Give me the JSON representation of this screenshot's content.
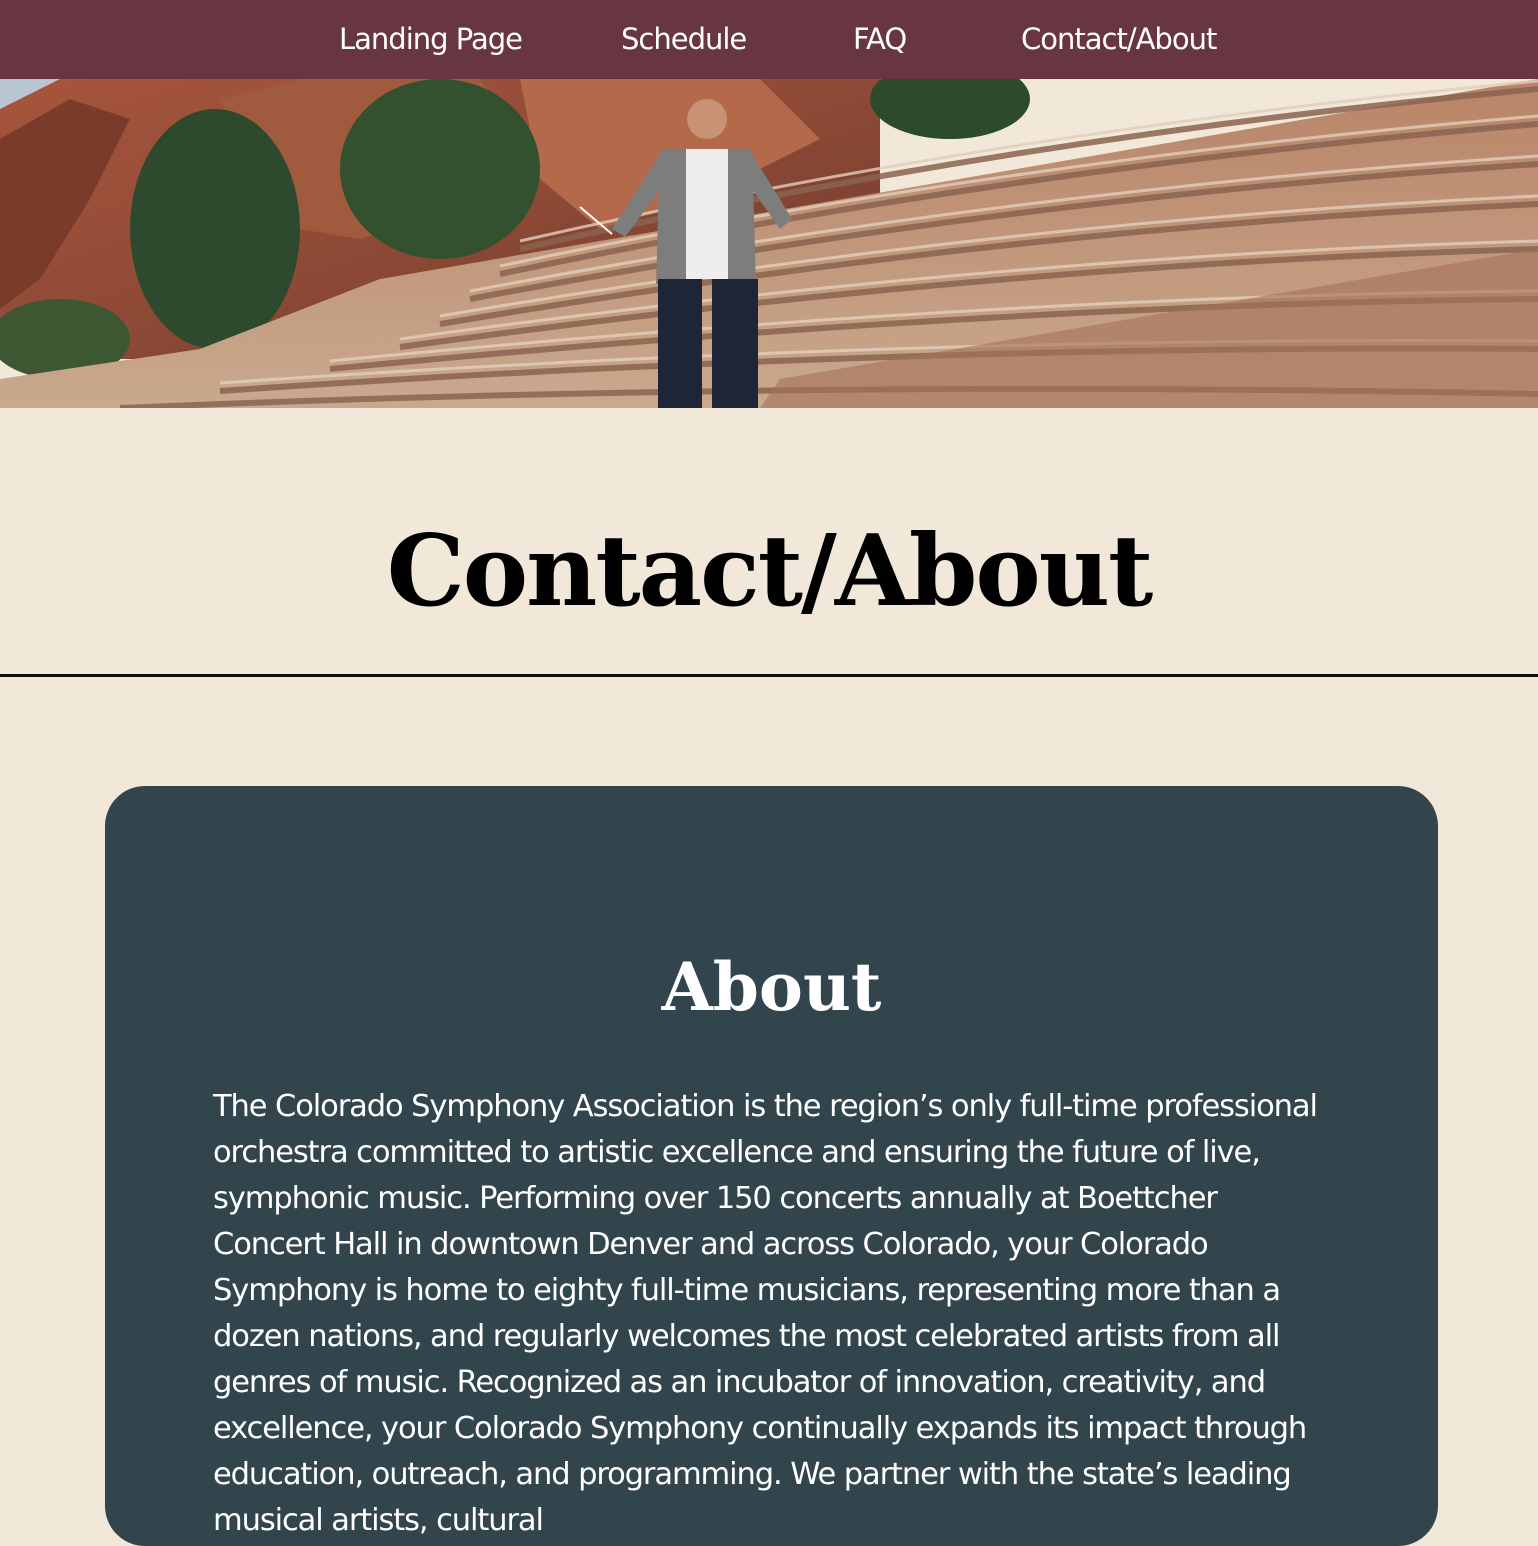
{
  "nav": {
    "items": [
      {
        "label": "Landing Page"
      },
      {
        "label": "Schedule"
      },
      {
        "label": "FAQ"
      },
      {
        "label": "Contact/About"
      }
    ]
  },
  "hero": {
    "image_icon": "conductor-at-amphitheater-photo"
  },
  "page": {
    "title": "Contact/About"
  },
  "about": {
    "heading": "About",
    "body": "The Colorado Symphony Association is the region’s only full-time professional orchestra committed to artistic excellence and ensuring the future of live, symphonic music. Performing over 150 concerts annually at Boettcher Concert Hall in downtown Denver and across Colorado, your Colorado Symphony is home to eighty full-time musicians, representing more than a dozen nations, and regularly welcomes the most celebrated artists from all genres of music. Recognized as an incubator of innovation, creativity, and excellence, your Colorado Symphony continually expands its impact through education, outreach, and programming. We partner with the state’s leading musical artists, cultural"
  },
  "colors": {
    "nav_bg": "#683641",
    "page_bg": "#f1e8da",
    "card_bg": "#32444c",
    "text_light": "#ffffff",
    "text_dark": "#000000"
  }
}
